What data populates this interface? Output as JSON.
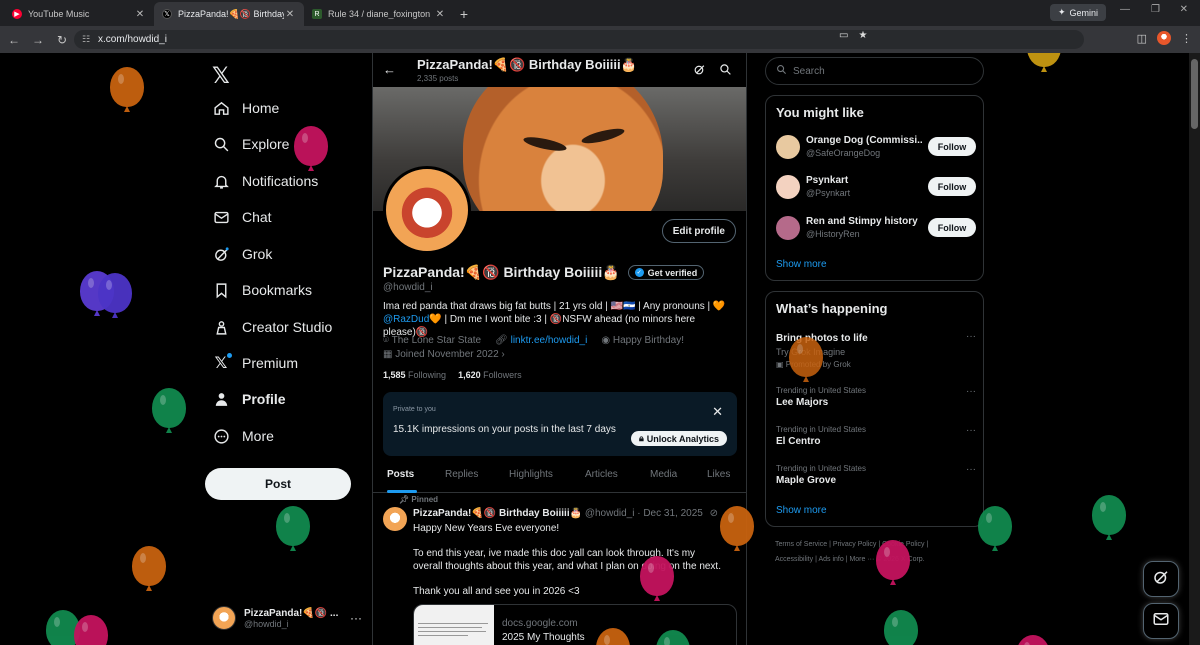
{
  "browser": {
    "tabs": [
      {
        "title": "YouTube Music",
        "icon": "youtube-music-icon",
        "color": "#ff0033"
      },
      {
        "title": "PizzaPanda!🍕🔞 Birthday Boiiiii🎂 (@howdid_i) / X",
        "icon": "x-logo-icon",
        "color": "#000000"
      },
      {
        "title": "Rule 34 / diane_foxington",
        "icon": "r34-icon",
        "color": "#2c5a2c"
      }
    ],
    "gemini_label": "Gemini",
    "url": "x.com/howdid_i"
  },
  "nav": {
    "items": [
      {
        "label": "Home",
        "icon": "home-icon"
      },
      {
        "label": "Explore",
        "icon": "search-icon"
      },
      {
        "label": "Notifications",
        "icon": "bell-icon"
      },
      {
        "label": "Chat",
        "icon": "mail-icon"
      },
      {
        "label": "Grok",
        "icon": "grok-icon"
      },
      {
        "label": "Bookmarks",
        "icon": "bookmark-icon"
      },
      {
        "label": "Creator Studio",
        "icon": "creator-studio-icon"
      },
      {
        "label": "Premium",
        "icon": "x-premium-icon"
      },
      {
        "label": "Profile",
        "icon": "person-icon"
      },
      {
        "label": "More",
        "icon": "more-circle-icon"
      }
    ],
    "post_label": "Post",
    "account": {
      "name": "PizzaPanda!🍕🔞 ...",
      "handle": "@howdid_i"
    }
  },
  "profile": {
    "header_name": "PizzaPanda!🍕🔞 Birthday Boiiiii🎂",
    "post_count": "2,335 posts",
    "edit_label": "Edit profile",
    "name": "PizzaPanda!🍕🔞 Birthday Boiiiii🎂",
    "verified_label": "Get verified",
    "handle": "@howdid_i",
    "bio_line1": "Ima red panda that draws big fat butts | 21 yrs old | 🇺🇸🇸🇻 | Any pronouns | 🧡",
    "bio_mention": "@RazDud🧡",
    "bio_line2": " | Dm me I wont bite :3 | 🔞NSFW ahead (no minors here please)🔞",
    "location": "The Lone Star State",
    "link": "linktr.ee/howdid_i",
    "birthday": "Happy Birthday!",
    "joined": "Joined November 2022",
    "following_count": "1,585",
    "following_label": "Following",
    "followers_count": "1,620",
    "followers_label": "Followers"
  },
  "analytics": {
    "private_label": "Private to you",
    "impressions": "15.1K impressions on your posts in the last 7 days",
    "unlock_label": "Unlock Analytics"
  },
  "profile_tabs": [
    "Posts",
    "Replies",
    "Highlights",
    "Articles",
    "Media",
    "Likes"
  ],
  "tweet": {
    "pinned_label": "Pinned",
    "author": "PizzaPanda!🍕🔞 Birthday Boiiiii🎂",
    "meta": "@howdid_i · Dec 31, 2025",
    "line1": "Happy New Years Eve everyone!",
    "line2": "To end this year, ive made this doc yall can look through. It's my overall thoughts about this year, and what I plan on doing on the next.",
    "line3": "Thank you all and see you in 2026 <3",
    "card_domain": "docs.google.com",
    "card_title": "2025 My Thoughts"
  },
  "right": {
    "search_placeholder": "Search",
    "might_like_title": "You might like",
    "suggestions": [
      {
        "name": "Orange Dog (Commissi...",
        "handle": "@SafeOrangeDog",
        "follow": "Follow",
        "color": "#e8c9a0"
      },
      {
        "name": "Psynkart",
        "handle": "@Psynkart",
        "follow": "Follow",
        "color": "#f3d2c0"
      },
      {
        "name": "Ren and Stimpy history",
        "handle": "@HistoryRen",
        "follow": "Follow",
        "color": "#b56a8a"
      }
    ],
    "show_more": "Show more",
    "happening_title": "What’s happening",
    "promo_title": "Bring photos to life",
    "promo_sub": "Try Grok Imagine",
    "promo_by": "Promoted by Grok",
    "trends": [
      {
        "context": "Trending in United States",
        "title": "Lee Majors"
      },
      {
        "context": "Trending in United States",
        "title": "El Centro"
      },
      {
        "context": "Trending in United States",
        "title": "Maple Grove"
      }
    ],
    "show_more2": "Show more",
    "footer_line1": "Terms of Service  |  Privacy Policy  |  Cookie Policy  |",
    "footer_line2": "Accessibility  |  Ads info  |  More ···  © 2026 X Corp."
  },
  "colors": {
    "balloon_orange": "#c8620f",
    "balloon_magenta": "#c4135e",
    "balloon_green": "#118a4f",
    "balloon_purple": "#5a3bd1",
    "balloon_gold": "#c99a12",
    "accent": "#1d9bf0"
  }
}
